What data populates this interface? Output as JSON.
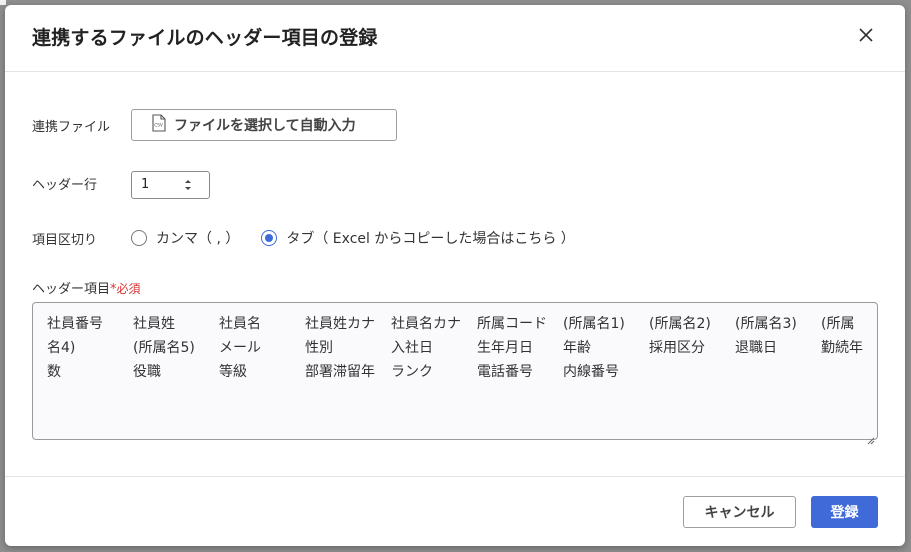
{
  "dialog": {
    "title": "連携するファイルのヘッダー項目の登録",
    "close_icon": "close-icon"
  },
  "file": {
    "label": "連携ファイル",
    "button_label": "ファイルを選択して自動入力",
    "icon": "csv-file-icon"
  },
  "header_row": {
    "label": "ヘッダー行",
    "value": "1"
  },
  "delimiter": {
    "label": "項目区切り",
    "options": [
      {
        "label": "カンマ（ , ）",
        "checked": false
      },
      {
        "label": "タブ（ Excel からコピーした場合はこちら ）",
        "checked": true
      }
    ]
  },
  "header_items": {
    "label": "ヘッダー項目",
    "required_mark": "*",
    "required_text": "必須",
    "value": "社員番号\t社員姓\t社員名\t社員姓カナ\t社員名カナ\t所属コード\t(所属名1)\t(所属名2)\t(所属名3)\t(所属名4)\t(所属名5)\tメール\t性別\t入社日\t生年月日\t年齢\t採用区分\t退職日\t勤続年数\t役職\t等級\t部署滞留年\tランク\t電話番号\t内線番号"
  },
  "footer": {
    "cancel_label": "キャンセル",
    "submit_label": "登録"
  },
  "colors": {
    "accent": "#3f6ad8",
    "required": "#dd3333"
  }
}
